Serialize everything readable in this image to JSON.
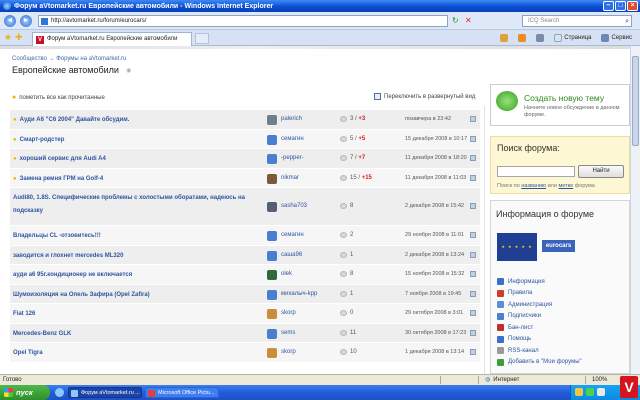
{
  "browser": {
    "window_title": "Форум aVtomarket.ru Европейские автомобили - Windows Internet Explorer",
    "address": "http://avtomarket.ru/forum/eurocars/",
    "search_placeholder": "ICQ Search",
    "tab_title": "Форум aVtomarket.ru Европейские автомобили",
    "tab_icon_letter": "V",
    "cmd_page": "Страница",
    "cmd_service": "Сервис"
  },
  "page": {
    "breadcrumb": "Сообщество → Форумы на aVtomarket.ru",
    "title": "Европейские автомобили",
    "mark_read": "пометить все как прочитанные",
    "expand_view": "Переключить в развернутый вид"
  },
  "topics": [
    {
      "title": "Ауди А6 \"С6 2004\" Давайте обсудим.",
      "bulb": true,
      "author": "palerich",
      "count": "3",
      "new": "+3",
      "date": "позавчера в 23:42",
      "avatar_color": "#6d7f8a"
    },
    {
      "title": "Смарт-родстер",
      "bulb": true,
      "author": "семагин",
      "count": "5",
      "new": "+5",
      "date": "15 декабря 2008 в 10:17",
      "avatar_color": "#4a7fd0"
    },
    {
      "title": "хороший сервис для Audi A4",
      "bulb": true,
      "author": "-pepper-",
      "count": "7",
      "new": "+7",
      "date": "11 декабря 2008 в 18:20",
      "avatar_color": "#4a7fd0"
    },
    {
      "title": "Замена ремня ГРМ на Golf-4",
      "bulb": true,
      "author": "nikmar",
      "count": "15",
      "new": "+15",
      "date": "11 декабря 2008 в 11:03",
      "avatar_color": "#7a5a3a"
    },
    {
      "title": "Audi80, 1.8S. Специфические проблемы с холостыми оборатами, надеюсь на подсказку",
      "bulb": false,
      "author": "sasha703",
      "count": "8",
      "new": "",
      "date": "2 декабря 2008 в 15:42",
      "avatar_color": "#556070",
      "tall": true
    },
    {
      "title": "Владельцы CL -отзовитесь!!!",
      "bulb": false,
      "author": "семагин",
      "count": "2",
      "new": "",
      "date": "29 ноября 2008 в 11:01",
      "avatar_color": "#4a7fd0"
    },
    {
      "title": "заводится и глохнет mercedes ML320",
      "bulb": false,
      "author": "саша96",
      "count": "1",
      "new": "",
      "date": "2 декабря 2008 в 13:24",
      "avatar_color": "#4a7fd0"
    },
    {
      "title": "ауди а6 95г.кондиционер не включается",
      "bulb": false,
      "author": "olek",
      "count": "8",
      "new": "",
      "date": "15 ноября 2008 в 15:32",
      "avatar_color": "#2f6a3a"
    },
    {
      "title": "Шумоизоляция на Опель Зафира (Opel Zafira)",
      "bulb": false,
      "author": "михалыч-kpp",
      "count": "1",
      "new": "",
      "date": "7 ноября 2008 в 19:45",
      "avatar_color": "#4a7fd0"
    },
    {
      "title": "Fiat 126",
      "bulb": false,
      "author": "skorp",
      "count": "0",
      "new": "",
      "date": "29 октября 2008 в 3:01",
      "avatar_color": "#c88e3a"
    },
    {
      "title": "Mercedes-Benz GLK",
      "bulb": false,
      "author": "sems",
      "count": "11",
      "new": "",
      "date": "30 октября 2008 в 17:23",
      "avatar_color": "#4a7fd0"
    },
    {
      "title": "Opel Tigra",
      "bulb": false,
      "author": "skorp",
      "count": "10",
      "new": "",
      "date": "1 декабря 2008 в 13:14",
      "avatar_color": "#c88e3a"
    }
  ],
  "sidebar": {
    "create_title": "Создать новую тему",
    "create_desc": "Начните новое обсуждение в данном форуме.",
    "search_title": "Поиск форума:",
    "search_button": "Найти",
    "search_hint_pre": "Поиск по",
    "search_hint_link1": "названию",
    "search_hint_mid": "или",
    "search_hint_link2": "метке",
    "search_hint_post": "форума",
    "info_title": "Информация о форуме",
    "info_badge": "eurocars",
    "links": [
      {
        "label": "Информация",
        "icon": "info-icon",
        "color": "#3b6fc8"
      },
      {
        "label": "Правила",
        "icon": "rules-icon",
        "color": "#d23a2a"
      },
      {
        "label": "Администрация",
        "icon": "admin-icon",
        "color": "#5b8fd8"
      },
      {
        "label": "Подписчики",
        "icon": "subscribers-icon",
        "color": "#4a7fd0"
      },
      {
        "label": "Бан-лист",
        "icon": "ban-icon",
        "color": "#c0302a"
      },
      {
        "label": "Помощь",
        "icon": "help-icon",
        "color": "#3b6fc8"
      },
      {
        "label": "RSS-канал",
        "icon": "rss-icon",
        "color": "#9a9a9a"
      },
      {
        "label": "Добавить в \"Мои форумы\"",
        "icon": "add-icon",
        "color": "#3aa03a"
      }
    ]
  },
  "status": {
    "left": "Готово",
    "zone": "Интернет",
    "zoom": "100%"
  },
  "taskbar": {
    "start": "пуск",
    "tasks": [
      {
        "label": "Форум aVtomarket.ru ...",
        "active": true,
        "icon_color": "#8cc8ff"
      },
      {
        "label": "Microsoft Office Pictu...",
        "active": false,
        "icon_color": "#e04040"
      }
    ],
    "clock": "",
    "corner_logo": "V"
  }
}
